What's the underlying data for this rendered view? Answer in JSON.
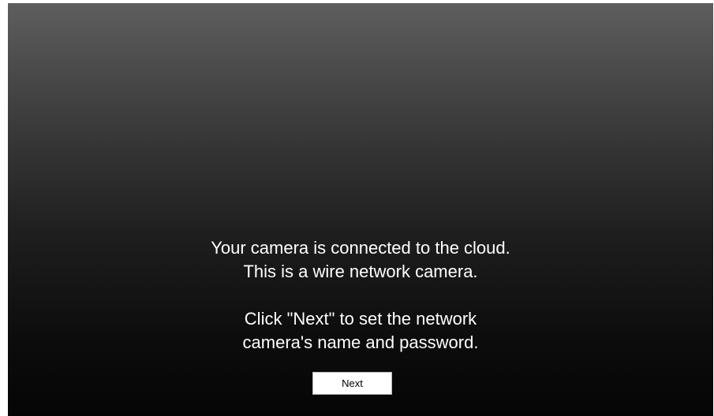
{
  "message": {
    "line1": "Your camera is connected to the cloud.",
    "line2": "This is a wire network camera.",
    "line3": "Click \"Next\" to set the network",
    "line4": "camera's name and password."
  },
  "actions": {
    "next_label": "Next"
  },
  "colors": {
    "background_top": "#5e5e5e",
    "background_bottom": "#050505",
    "text": "#ffffff",
    "button_bg": "#ffffff"
  }
}
